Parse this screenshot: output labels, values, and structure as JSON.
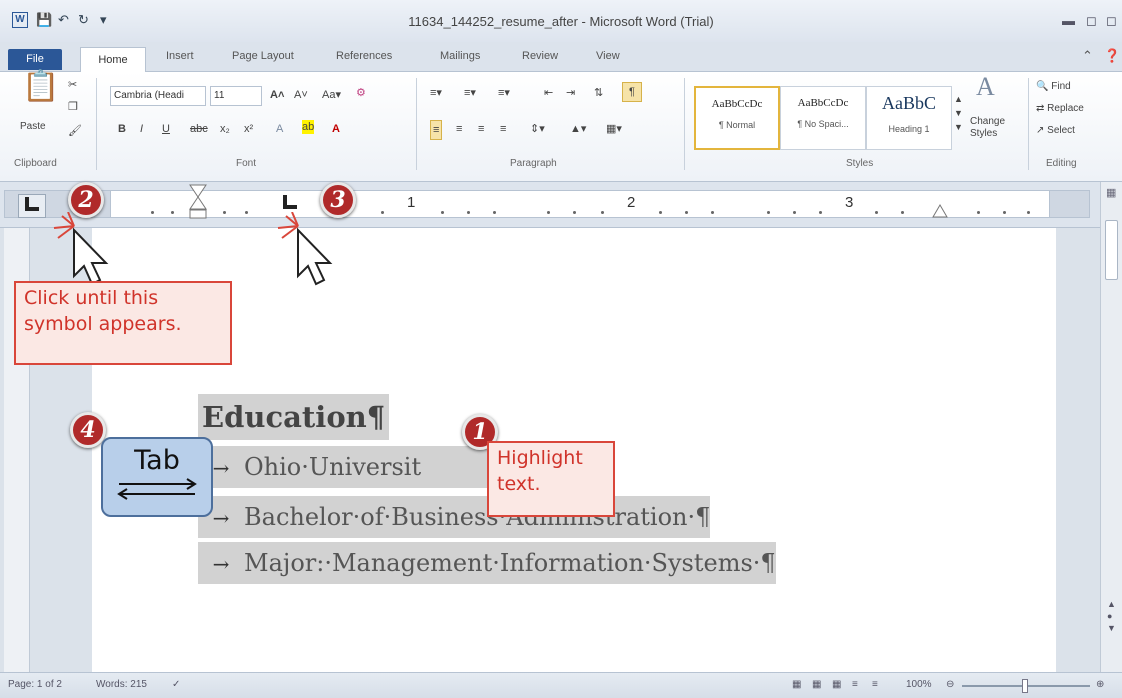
{
  "window": {
    "title": "11634_144252_resume_after - Microsoft Word (Trial)",
    "word_icon": "W"
  },
  "ribbon": {
    "tabs": [
      "File",
      "Home",
      "Insert",
      "Page Layout",
      "References",
      "Mailings",
      "Review",
      "View"
    ],
    "clipboard": {
      "paste": "Paste",
      "label": "Clipboard"
    },
    "font": {
      "name": "Cambria (Headi",
      "size": "11",
      "bold": "B",
      "italic": "I",
      "underline": "U",
      "label": "Font"
    },
    "paragraph": {
      "label": "Paragraph"
    },
    "styles": {
      "items": [
        {
          "sample": "AaBbCcDc",
          "name": "¶ Normal"
        },
        {
          "sample": "AaBbCcDc",
          "name": "¶ No Spaci..."
        },
        {
          "sample": "AaBbC",
          "name": "Heading 1"
        }
      ],
      "change_styles": "Change Styles",
      "label": "Styles"
    },
    "editing": {
      "find": "Find",
      "replace": "Replace",
      "select": "Select",
      "label": "Editing"
    }
  },
  "ruler": {
    "numbers": [
      "1",
      "2",
      "3"
    ]
  },
  "document": {
    "heading": "Education¶",
    "lines": [
      "Ohio·Universit",
      "Bachelor·of·Business·Administration·¶",
      "Major:·Management·Information·Systems·¶"
    ]
  },
  "annotations": {
    "badge_1": "1",
    "badge_2": "2",
    "badge_3": "3",
    "badge_4": "4",
    "click_callout": "Click until this symbol appears.",
    "highlight_callout": "Highlight text.",
    "tab_key": "Tab"
  },
  "statusbar": {
    "page": "Page: 1 of 2",
    "words": "Words: 215",
    "zoom": "100%"
  }
}
